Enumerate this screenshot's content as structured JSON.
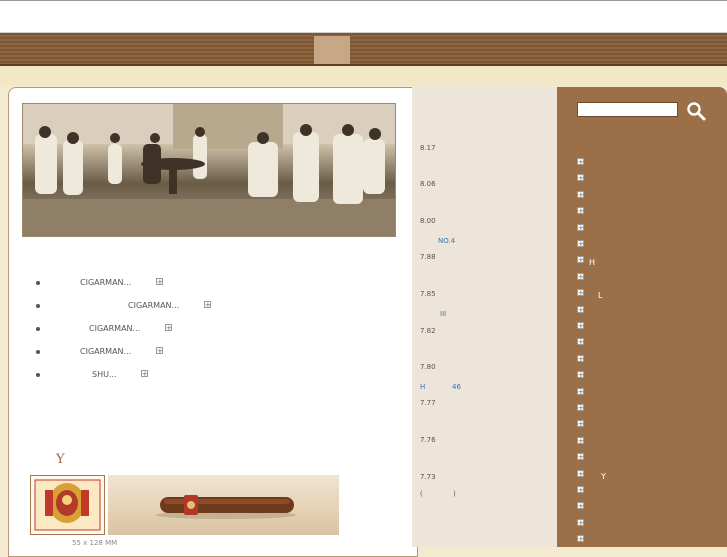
{
  "header": {
    "nav_active_label": ""
  },
  "bullets": [
    {
      "label": "CIGARMAN..."
    },
    {
      "label": "CIGARMAN..."
    },
    {
      "label": "CIGARMAN..."
    },
    {
      "label": "CIGARMAN..."
    },
    {
      "label": "SHU..."
    }
  ],
  "section_title": "Y",
  "banner_caption": "55 x 128 MM",
  "ranking": {
    "scores": [
      "8.17",
      "8.06",
      "8.00",
      "7.88",
      "7.85",
      "7.82",
      "7.80",
      "7.77",
      "7.76",
      "7.73"
    ],
    "links": [
      "NO.4",
      "III",
      "H",
      "46"
    ],
    "extra_text": [
      "(",
      ")"
    ]
  },
  "right": {
    "search_placeholder": "",
    "labels": [
      "H",
      "L",
      "Y"
    ]
  },
  "colors": {
    "brown": "#9b7048",
    "link": "#3b73b8",
    "cream": "#f2e8c8"
  }
}
